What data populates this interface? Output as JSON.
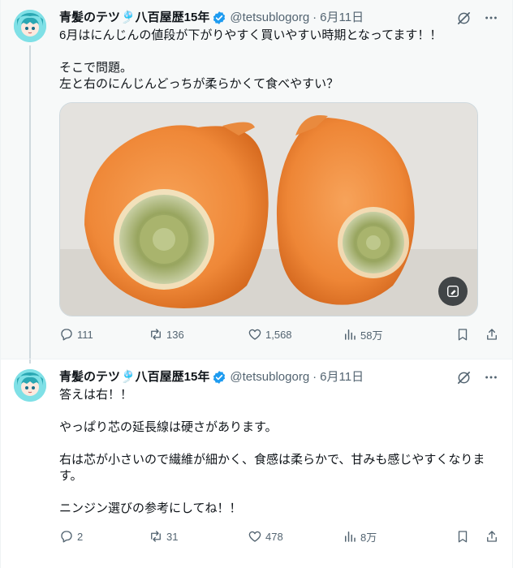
{
  "tweets": [
    {
      "author_name": "青髪のテツ🎐八百屋歴15年",
      "handle": "@tetsublogorg",
      "separator": "·",
      "date": "6月11日",
      "text_lines": [
        "6月はにんじんの値段が下がりやすく買いやすい時期となってます！！",
        "そこで問題。",
        "左と右のにんじんどっちが柔らかくて食べやすい？"
      ],
      "media_description_icon": "two-carrots-photo",
      "stats": {
        "replies": "111",
        "retweets": "136",
        "likes": "1,568",
        "views": "58万"
      }
    },
    {
      "author_name": "青髪のテツ🎐八百屋歴15年",
      "handle": "@tetsublogorg",
      "separator": "·",
      "date": "6月11日",
      "text_lines": [
        "答えは右！！",
        "やっぱり芯の延長線は硬さがあります。",
        "右は芯が小さいので繊維が細かく、食感は柔らかで、甘みも感じやすくなります。",
        "ニンジン選びの参考にしてね！！"
      ],
      "stats": {
        "replies": "2",
        "retweets": "31",
        "likes": "478",
        "views": "8万"
      }
    }
  ],
  "colors": {
    "text": "#0f1419",
    "secondary": "#536471",
    "verified": "#1d9bf0",
    "carrot": "#f08a3c"
  }
}
